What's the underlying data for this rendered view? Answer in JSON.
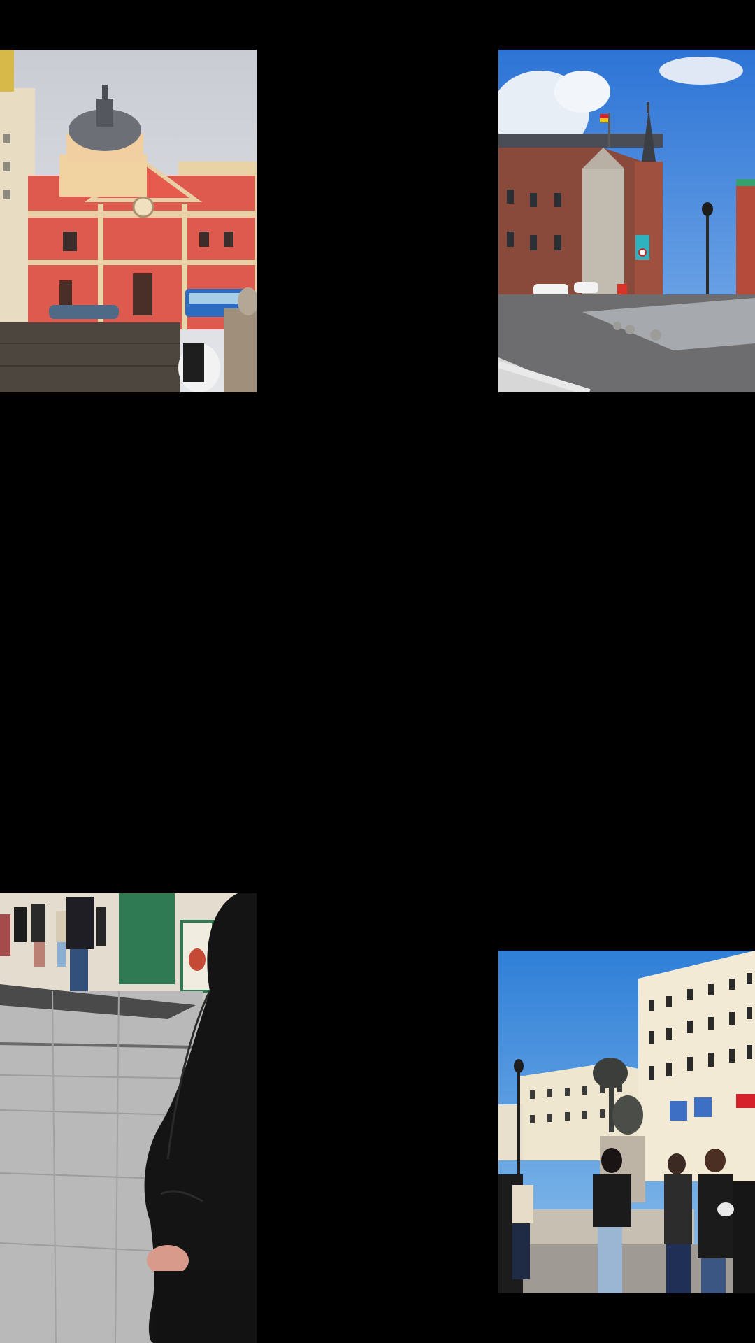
{
  "layout": {
    "background": "#000000"
  },
  "photos": [
    {
      "id": "p1",
      "icon": "church-red-facade-photo"
    },
    {
      "id": "p2",
      "icon": "palace-plaza-spire-photo"
    },
    {
      "id": "p3",
      "icon": "pedestrian-street-photo"
    },
    {
      "id": "p4",
      "icon": "plaza-bear-statue-photo"
    }
  ]
}
